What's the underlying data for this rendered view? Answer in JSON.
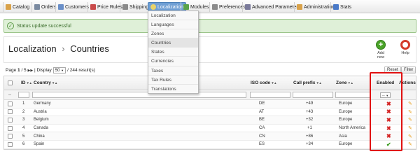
{
  "nav": {
    "tabs": [
      {
        "label": "Catalog",
        "color": "#d9a24a"
      },
      {
        "label": "Orders",
        "color": "#7a8aa0"
      },
      {
        "label": "Customers",
        "color": "#6a8fc8"
      },
      {
        "label": "Price Rules",
        "color": "#c94a4a"
      },
      {
        "label": "Shipping",
        "color": "#8a8a8a"
      },
      {
        "label": "Localization",
        "color": "#ffffff"
      },
      {
        "label": "Modules",
        "color": "#5aa34a"
      },
      {
        "label": "Preferences",
        "color": "#8a8a8a"
      },
      {
        "label": "Advanced Parameters",
        "color": "#7a7a9a"
      },
      {
        "label": "Administration",
        "color": "#d9a24a"
      },
      {
        "label": "Stats",
        "color": "#4a7ac8"
      }
    ],
    "active_tab": "Localization"
  },
  "dropdown": {
    "items": [
      "Localization",
      "Languages",
      "Zones",
      "Countries",
      "States",
      "Currencies",
      "Taxes",
      "Tax Rules",
      "Translations"
    ],
    "hovered": "Countries"
  },
  "status": {
    "message": "Status update successful",
    "icon": "check-icon"
  },
  "toolbar": {
    "breadcrumb_parent": "Localization",
    "breadcrumb_sep": "›",
    "breadcrumb_current": "Countries",
    "add_label": "Add new",
    "help_label": "Help"
  },
  "pager": {
    "page_label": "Page",
    "page_current": "1",
    "page_total": "/ 5",
    "display_label": "| Display",
    "per_page": "50",
    "result_count": "/ 244 result(s)"
  },
  "buttons": {
    "reset": "Reset",
    "filter": "Filter"
  },
  "table": {
    "headers": {
      "id": "ID",
      "country": "Country",
      "iso": "ISO code",
      "call": "Call prefix",
      "zone": "Zone",
      "enabled": "Enabled",
      "actions": "Actions"
    },
    "filters": {
      "dash": "--",
      "enabled_select": "--"
    },
    "rows": [
      {
        "id": "1",
        "country": "Germany",
        "iso": "DE",
        "call": "+49",
        "zone": "Europe",
        "enabled": "✖"
      },
      {
        "id": "2",
        "country": "Austria",
        "iso": "AT",
        "call": "+43",
        "zone": "Europe",
        "enabled": "✖"
      },
      {
        "id": "3",
        "country": "Belgium",
        "iso": "BE",
        "call": "+32",
        "zone": "Europe",
        "enabled": "✖"
      },
      {
        "id": "4",
        "country": "Canada",
        "iso": "CA",
        "call": "+1",
        "zone": "North America",
        "enabled": "✖"
      },
      {
        "id": "5",
        "country": "China",
        "iso": "CN",
        "call": "+86",
        "zone": "Asia",
        "enabled": "✖"
      },
      {
        "id": "6",
        "country": "Spain",
        "iso": "ES",
        "call": "+34",
        "zone": "Europe",
        "enabled": "✔"
      }
    ]
  },
  "colors": {
    "success_bg": "#dff0d8",
    "active_tab": "#6f9fd4",
    "highlight": "#e01010",
    "disabled_x": "#d42424",
    "enabled_check": "#3a9a1f"
  }
}
